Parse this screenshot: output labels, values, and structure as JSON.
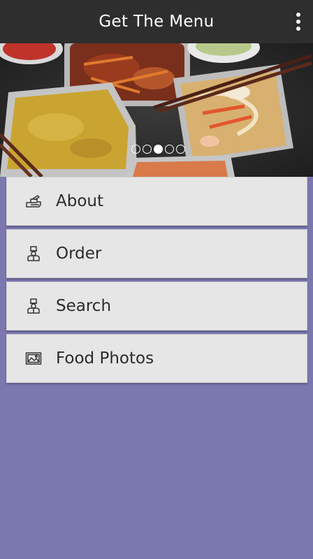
{
  "header": {
    "title": "Get The Menu",
    "menu_icon": "overflow-vertical-icon"
  },
  "hero": {
    "pages": 5,
    "active_page": 3
  },
  "menu": {
    "items": [
      {
        "label": "About",
        "icon": "hand-pointer-icon"
      },
      {
        "label": "Order",
        "icon": "chef-icon"
      },
      {
        "label": "Search",
        "icon": "chef-icon"
      },
      {
        "label": "Food Photos",
        "icon": "photo-icon"
      }
    ]
  },
  "colors": {
    "app_bar": "#2e2e2e",
    "background": "#7b78b0",
    "menu_item": "#e6e6e6"
  }
}
